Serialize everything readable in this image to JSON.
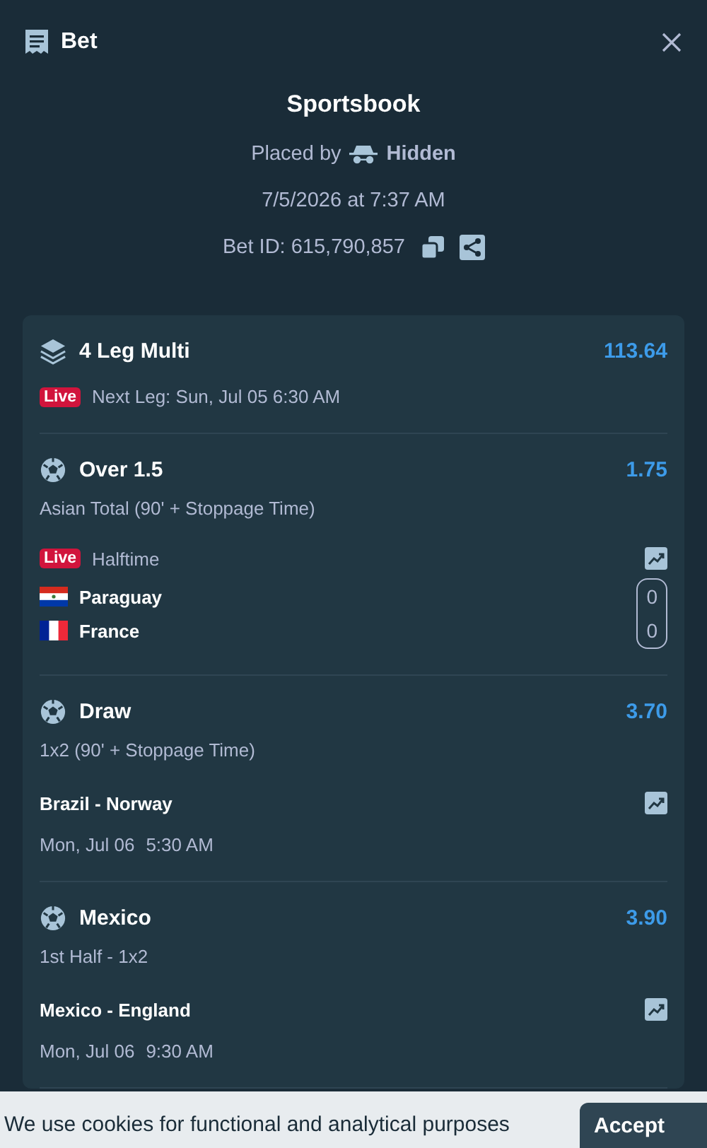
{
  "header": {
    "title": "Bet"
  },
  "summary": {
    "provider": "Sportsbook",
    "placed_by_label": "Placed by",
    "placed_by_user": "Hidden",
    "placed_at": "7/5/2026 at 7:37 AM",
    "bet_id": "Bet ID: 615,790,857"
  },
  "multi": {
    "title": "4 Leg Multi",
    "odds": "113.64",
    "live_badge": "Live",
    "next_leg": "Next Leg: Sun, Jul 05 6:30 AM"
  },
  "legs": [
    {
      "kind": "live",
      "selection": "Over 1.5",
      "odds": "1.75",
      "market": "Asian Total (90' + Stoppage Time)",
      "live_badge": "Live",
      "status": "Halftime",
      "teams": [
        {
          "name": "Paraguay",
          "kind": "paraguay",
          "score": "0"
        },
        {
          "name": "France",
          "kind": "france",
          "score": "0"
        }
      ]
    },
    {
      "kind": "scheduled",
      "selection": "Draw",
      "odds": "3.70",
      "market": "1x2 (90' + Stoppage Time)",
      "match": "Brazil - Norway",
      "date": "Mon, Jul 06",
      "time": "5:30 AM"
    },
    {
      "kind": "scheduled",
      "selection": "Mexico",
      "odds": "3.90",
      "market": "1st Half - 1x2",
      "match": "Mexico - England",
      "date": "Mon, Jul 06",
      "time": "9:30 AM"
    }
  ],
  "cookie_banner": {
    "text": "We use cookies for functional and analytical purposes",
    "button": "Accept"
  }
}
